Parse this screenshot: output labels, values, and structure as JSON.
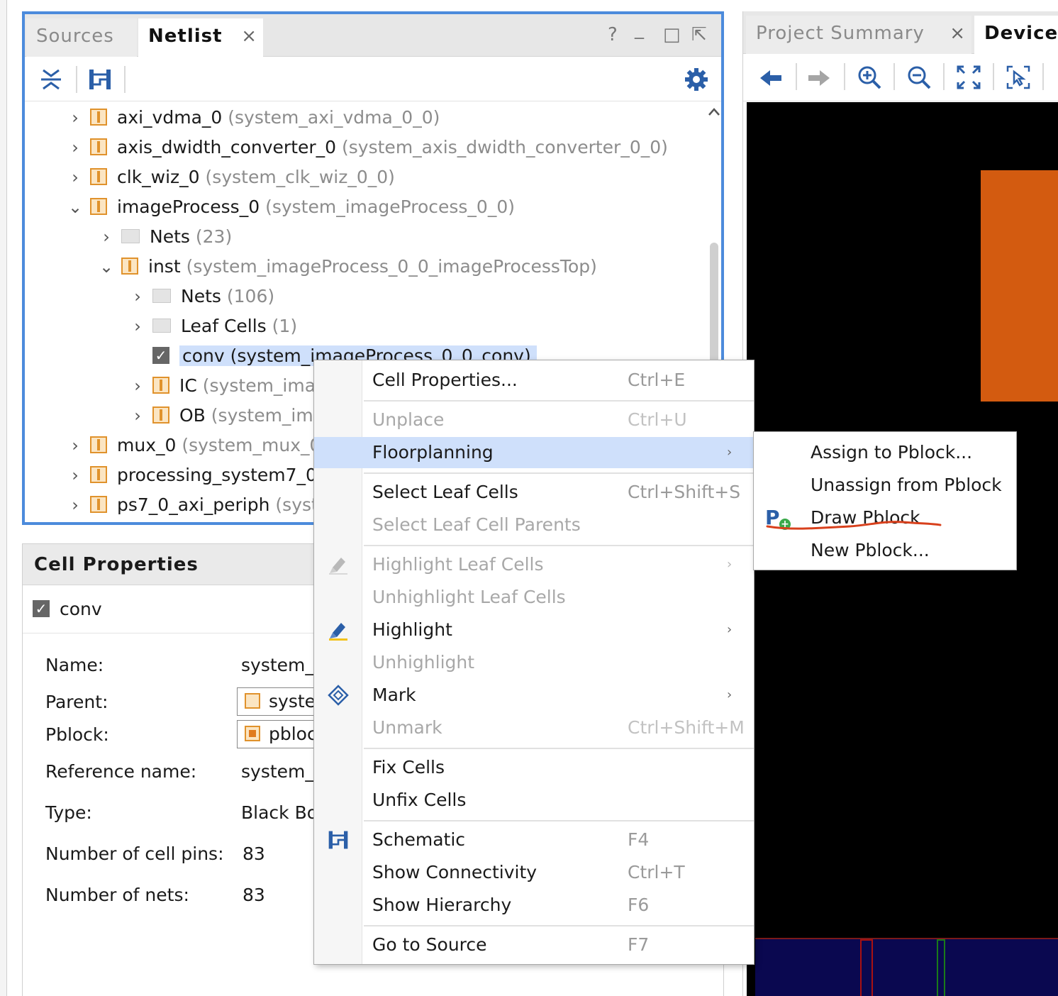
{
  "netlist": {
    "tabs": {
      "sources": "Sources",
      "netlist": "Netlist",
      "close": "×"
    },
    "window_controls": {
      "help": "?",
      "minimize": "_",
      "maximize": "□",
      "float": "⇱"
    },
    "tree": [
      {
        "name": "axi_vdma_0",
        "sub": "(system_axi_vdma_0_0)",
        "chev": "›",
        "icon": "cell"
      },
      {
        "name": "axis_dwidth_converter_0",
        "sub": "(system_axis_dwidth_converter_0_0)",
        "chev": "›",
        "icon": "cell"
      },
      {
        "name": "clk_wiz_0",
        "sub": "(system_clk_wiz_0_0)",
        "chev": "›",
        "icon": "cell"
      },
      {
        "name": "imageProcess_0",
        "sub": "(system_imageProcess_0_0)",
        "chev": "⌄",
        "icon": "cell"
      },
      {
        "name": "Nets",
        "sub": "(23)",
        "chev": "›",
        "icon": "folder"
      },
      {
        "name": "inst",
        "sub": "(system_imageProcess_0_0_imageProcessTop)",
        "chev": "⌄",
        "icon": "cell"
      },
      {
        "name": "Nets",
        "sub": "(106)",
        "chev": "›",
        "icon": "folder"
      },
      {
        "name": "Leaf Cells",
        "sub": "(1)",
        "chev": "›",
        "icon": "folder"
      },
      {
        "name": "conv",
        "sub": "(system_imageProcess_0_0_conv)",
        "chev": "",
        "icon": "check"
      },
      {
        "name": "IC",
        "sub": "(system_imag",
        "chev": "›",
        "icon": "cell"
      },
      {
        "name": "OB",
        "sub": "(system_ima",
        "chev": "›",
        "icon": "cell"
      },
      {
        "name": "mux_0",
        "sub": "(system_mux_0",
        "chev": "›",
        "icon": "cell"
      },
      {
        "name": "processing_system7_0",
        "sub": "",
        "chev": "›",
        "icon": "cell"
      },
      {
        "name": "ps7_0_axi_periph",
        "sub": "(syst",
        "chev": "›",
        "icon": "cell"
      }
    ]
  },
  "cell_properties": {
    "title": "Cell Properties",
    "selected": "conv",
    "fields": [
      {
        "label": "Name:",
        "value": "system_"
      },
      {
        "label": "Parent:",
        "value": "syste"
      },
      {
        "label": "Pblock:",
        "value": "pbloc"
      },
      {
        "label": "Reference name:",
        "value": "system_"
      },
      {
        "label": "Type:",
        "value": "Black Bo"
      },
      {
        "label": "Number of cell pins:",
        "value": "83"
      },
      {
        "label": "Number of nets:",
        "value": "83"
      }
    ]
  },
  "device": {
    "tabs": {
      "project_summary": "Project Summary",
      "close": "×",
      "device": "Device"
    }
  },
  "context_menu": {
    "items": [
      {
        "label": "Cell Properties...",
        "shortcut": "Ctrl+E"
      },
      {
        "label": "Unplace",
        "shortcut": "Ctrl+U"
      },
      {
        "label": "Floorplanning",
        "shortcut": ""
      },
      {
        "label": "Select Leaf Cells",
        "shortcut": "Ctrl+Shift+S"
      },
      {
        "label": "Select Leaf Cell Parents",
        "shortcut": ""
      },
      {
        "label": "Highlight Leaf Cells",
        "shortcut": ""
      },
      {
        "label": "Unhighlight Leaf Cells",
        "shortcut": ""
      },
      {
        "label": "Highlight",
        "shortcut": ""
      },
      {
        "label": "Unhighlight",
        "shortcut": ""
      },
      {
        "label": "Mark",
        "shortcut": ""
      },
      {
        "label": "Unmark",
        "shortcut": "Ctrl+Shift+M"
      },
      {
        "label": "Fix Cells",
        "shortcut": ""
      },
      {
        "label": "Unfix Cells",
        "shortcut": ""
      },
      {
        "label": "Schematic",
        "shortcut": "F4"
      },
      {
        "label": "Show Connectivity",
        "shortcut": "Ctrl+T"
      },
      {
        "label": "Show Hierarchy",
        "shortcut": "F6"
      },
      {
        "label": "Go to Source",
        "shortcut": "F7"
      }
    ],
    "submenu_arrow": "›"
  },
  "floorplanning_submenu": {
    "items": [
      "Assign to Pblock...",
      "Unassign from Pblock",
      "Draw Pblock",
      "New Pblock..."
    ],
    "icon_letter": "P",
    "icon_plus": "+"
  },
  "colors": {
    "panel_border": "#4c8bdc",
    "selection": "#cfe0fb",
    "pblock_orange": "#d35b10",
    "annotation_red": "#d8401c",
    "cell_icon": "#e0922c"
  }
}
